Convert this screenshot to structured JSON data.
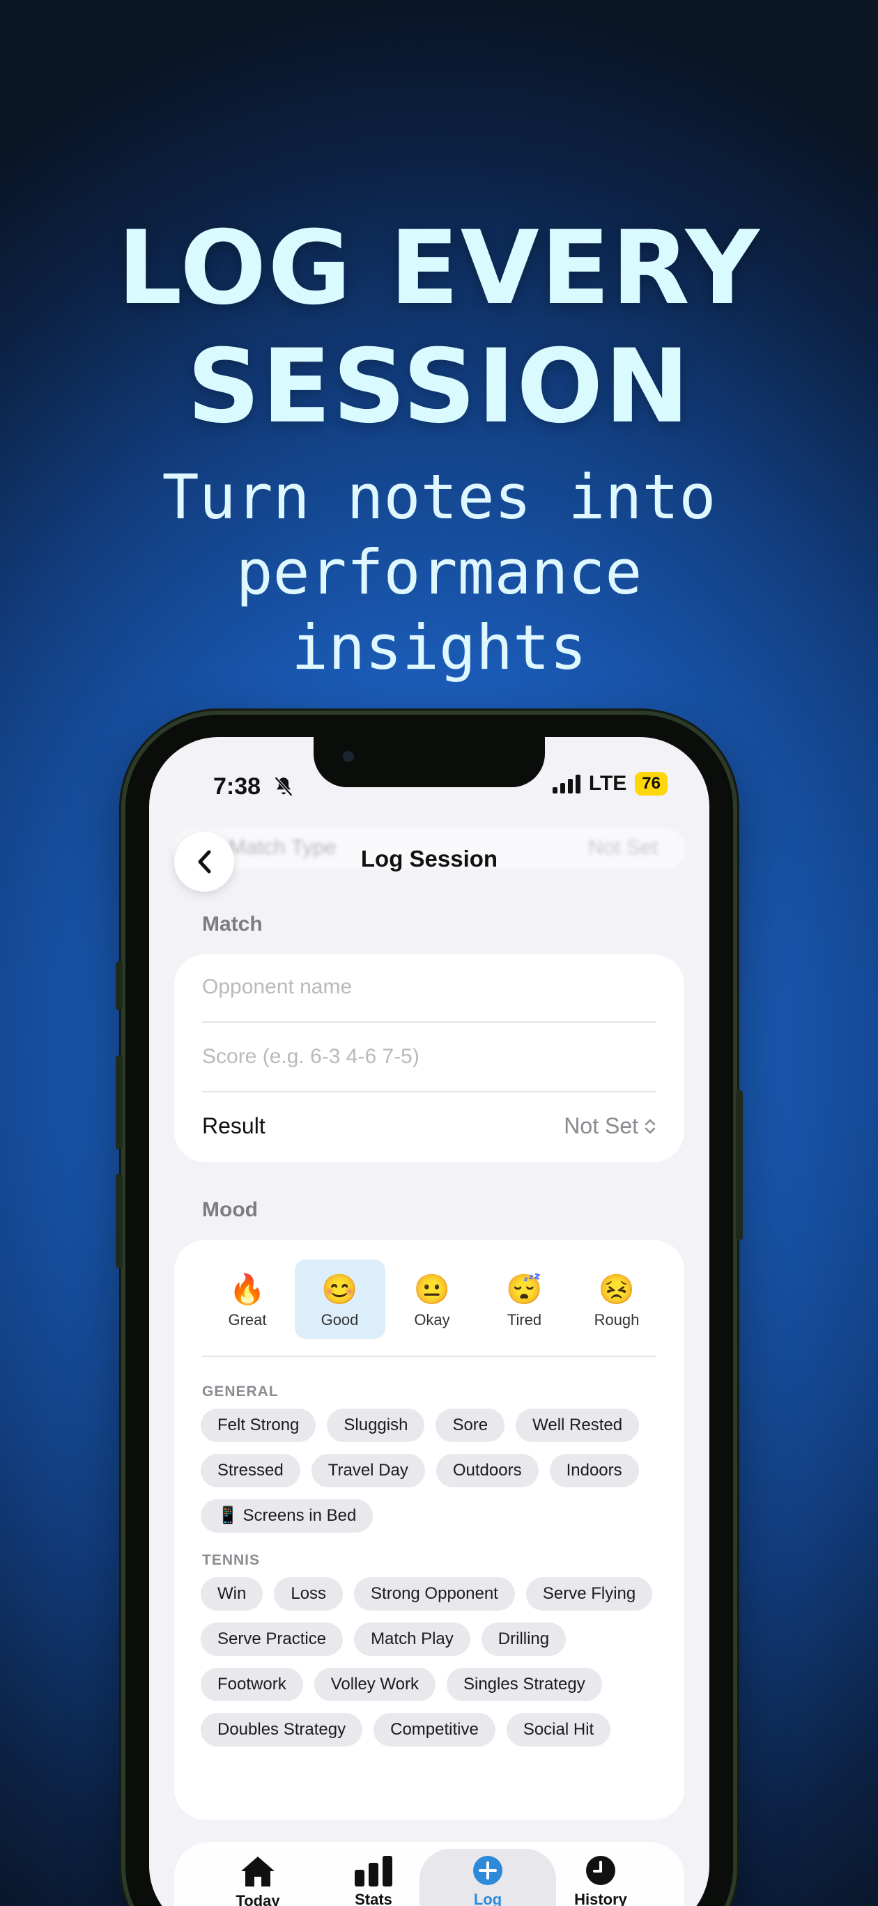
{
  "promo": {
    "headline_line1": "LOG EVERY",
    "headline_line2": "SESSION",
    "sub_line1": "Turn notes into",
    "sub_line2": "performance",
    "sub_line3": "insights"
  },
  "status_bar": {
    "time": "7:38",
    "network": "LTE",
    "battery": "76"
  },
  "nav": {
    "title": "Log Session",
    "behind_label": "Match Type",
    "behind_value": "Not Set"
  },
  "match": {
    "section_label": "Match",
    "opponent_placeholder": "Opponent name",
    "score_placeholder": "Score (e.g. 6-3 4-6 7-5)",
    "result_label": "Result",
    "result_value": "Not Set"
  },
  "mood": {
    "section_label": "Mood",
    "options": [
      {
        "emoji": "🔥",
        "label": "Great"
      },
      {
        "emoji": "😊",
        "label": "Good"
      },
      {
        "emoji": "😐",
        "label": "Okay"
      },
      {
        "emoji": "😴",
        "label": "Tired"
      },
      {
        "emoji": "😣",
        "label": "Rough"
      }
    ],
    "selected": "Good"
  },
  "tags": {
    "general_label": "GENERAL",
    "general": [
      "Felt Strong",
      "Sluggish",
      "Sore",
      "Well Rested",
      "Stressed",
      "Travel Day",
      "Outdoors",
      "Indoors",
      "📱 Screens in Bed"
    ],
    "tennis_label": "TENNIS",
    "tennis": [
      "Win",
      "Loss",
      "Strong Opponent",
      "Serve Flying",
      "Serve Practice",
      "Match Play",
      "Drilling",
      "Footwork",
      "Volley Work",
      "Singles Strategy",
      "Doubles Strategy",
      "Competitive",
      "Social Hit"
    ]
  },
  "tabbar": {
    "today": "Today",
    "stats": "Stats",
    "log": "Log",
    "history": "History",
    "active": "Log"
  },
  "colors": {
    "accent": "#2c8ad8",
    "selected_mood_bg": "#dceef9",
    "battery": "#ffd60a",
    "headline": "#d9fbff"
  }
}
